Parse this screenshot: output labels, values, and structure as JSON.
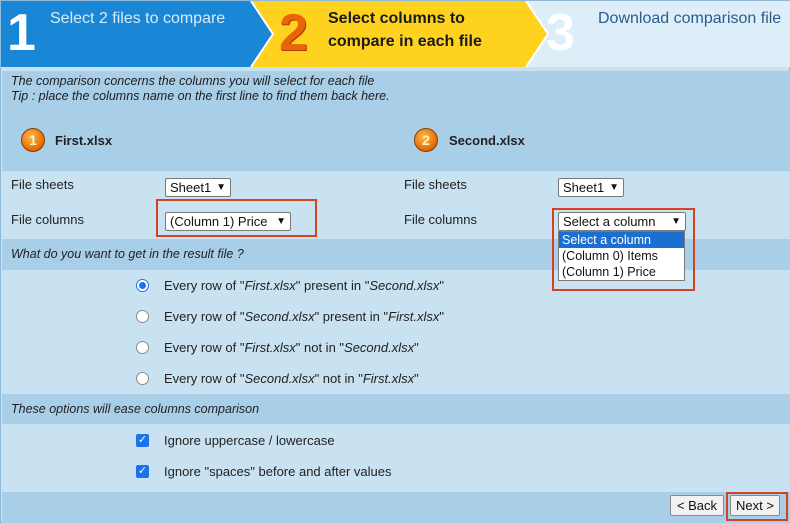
{
  "wizard": {
    "steps": [
      {
        "number": "1",
        "label": "Select 2 files to compare",
        "state": "done"
      },
      {
        "number": "2",
        "label": "Select columns to compare in each file",
        "state": "active"
      },
      {
        "number": "3",
        "label": "Download comparison file",
        "state": "pending"
      }
    ]
  },
  "info": {
    "line1": "The comparison concerns the columns you will select for each file",
    "line2": "Tip : place the columns name on the first line to find them back here."
  },
  "files": {
    "first": {
      "badge": "1",
      "name": "First.xlsx",
      "sheets_label": "File sheets",
      "sheet_value": "Sheet1",
      "columns_label": "File columns",
      "column_value": "(Column 1) Price"
    },
    "second": {
      "badge": "2",
      "name": "Second.xlsx",
      "sheets_label": "File sheets",
      "sheet_value": "Sheet1",
      "columns_label": "File columns",
      "column_value": "Select a column",
      "column_options": [
        "Select a column",
        "(Column 0) Items",
        "(Column 1) Price"
      ]
    }
  },
  "result_question": "What do you want to get in the result file ?",
  "result_options": [
    {
      "pre": "Every row of \"",
      "f1": "First.xlsx",
      "mid": "\" present in \"",
      "f2": "Second.xlsx",
      "post": "\"",
      "selected": true
    },
    {
      "pre": "Every row of \"",
      "f1": "Second.xlsx",
      "mid": "\" present in \"",
      "f2": "First.xlsx",
      "post": "\"",
      "selected": false
    },
    {
      "pre": "Every row of \"",
      "f1": "First.xlsx",
      "mid": "\" not in \"",
      "f2": "Second.xlsx",
      "post": "\"",
      "selected": false
    },
    {
      "pre": "Every row of \"",
      "f1": "Second.xlsx",
      "mid": "\" not in \"",
      "f2": "First.xlsx",
      "post": "\"",
      "selected": false
    }
  ],
  "ease_heading": "These options will ease columns comparison",
  "ease_options": [
    {
      "label": "Ignore uppercase / lowercase",
      "checked": true
    },
    {
      "label": "Ignore \"spaces\" before and after values",
      "checked": true
    }
  ],
  "footer": {
    "back_label": "< Back",
    "next_label": "Next >"
  },
  "colors": {
    "header_blue": "#1a86d6",
    "header_yellow": "#ffd21f",
    "highlight_red": "#d6411f",
    "panel_dark": "#a9cfe8",
    "panel_light": "#c8e2f2"
  }
}
